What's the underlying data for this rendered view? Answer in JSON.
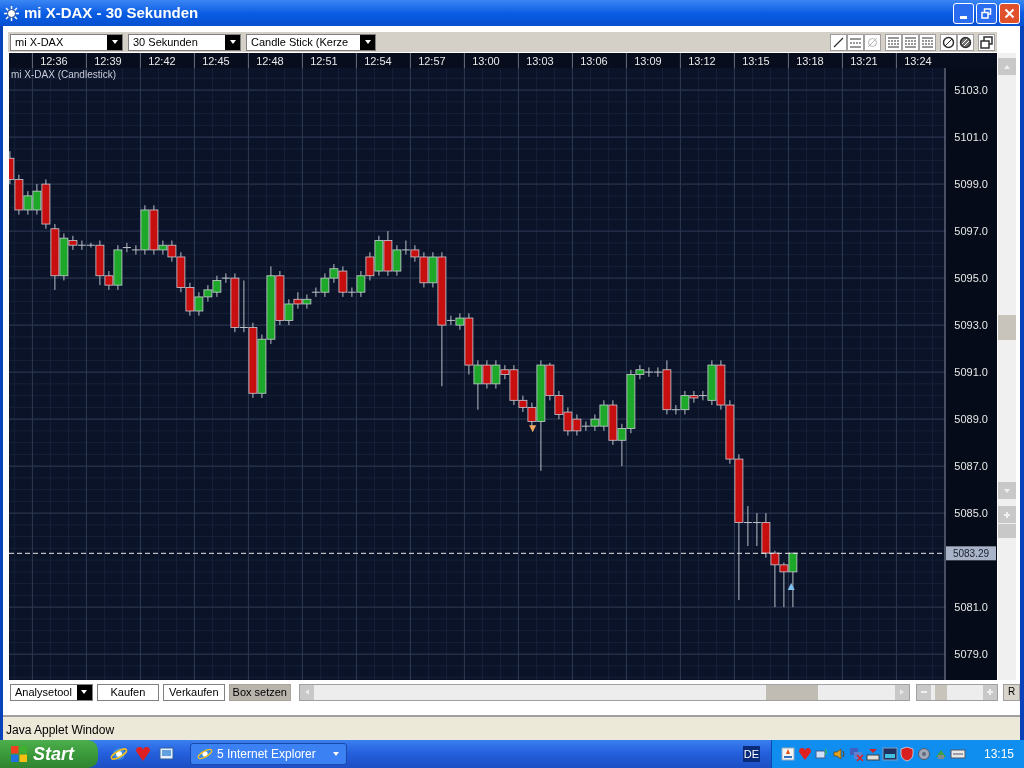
{
  "window": {
    "title": "mi X-DAX - 30 Sekunden"
  },
  "toolbar": {
    "dropdowns": [
      {
        "value": "mi X-DAX"
      },
      {
        "value": "30 Sekunden"
      },
      {
        "value": "Candle Stick (Kerze"
      }
    ],
    "tools": [
      {
        "kind": "line",
        "disabled": false
      },
      {
        "kind": "hlines",
        "disabled": false
      },
      {
        "kind": "slash",
        "disabled": true
      },
      {
        "kind": "grid",
        "disabled": false
      },
      {
        "kind": "grid",
        "disabled": false
      },
      {
        "kind": "grid",
        "disabled": false
      },
      {
        "kind": "target",
        "disabled": false
      },
      {
        "kind": "hatch",
        "disabled": false
      },
      {
        "kind": "windows",
        "disabled": false
      }
    ]
  },
  "chart": {
    "chart_data": {
      "type": "candlestick",
      "title": "mi X-DAX (Candlestick)",
      "grid": true,
      "ylim": [
        5077.9,
        5103.94
      ],
      "yticks": [
        {
          "value": 5103,
          "label": "5103.0"
        },
        {
          "value": 5101,
          "label": "5101.0"
        },
        {
          "value": 5099,
          "label": "5099.0"
        },
        {
          "value": 5097,
          "label": "5097.0"
        },
        {
          "value": 5095,
          "label": "5095.0"
        },
        {
          "value": 5093,
          "label": "5093.0"
        },
        {
          "value": 5091,
          "label": "5091.0"
        },
        {
          "value": 5089,
          "label": "5089.0"
        },
        {
          "value": 5087,
          "label": "5087.0"
        },
        {
          "value": 5085,
          "label": "5085.0"
        },
        {
          "value": 5081,
          "label": "5081.0"
        },
        {
          "value": 5079,
          "label": "5079.0"
        }
      ],
      "categories": [
        null,
        null,
        null,
        null,
        null,
        "12:36",
        null,
        null,
        null,
        null,
        null,
        "12:39",
        null,
        null,
        null,
        null,
        null,
        "12:42",
        null,
        null,
        null,
        null,
        null,
        "12:45",
        null,
        null,
        null,
        null,
        null,
        "12:48",
        null,
        null,
        null,
        null,
        null,
        "12:51",
        null,
        null,
        null,
        null,
        null,
        "12:54",
        null,
        null,
        null,
        null,
        null,
        "12:57",
        null,
        null,
        null,
        null,
        null,
        "13:00",
        null,
        null,
        null,
        null,
        null,
        "13:03",
        null,
        null,
        null,
        null,
        null,
        "13:06",
        null,
        null,
        null,
        null,
        null,
        "13:09",
        null,
        null,
        null,
        null,
        null,
        "13:12",
        null,
        null,
        null,
        null,
        null,
        "13:15",
        null,
        null,
        null,
        null,
        null,
        "13:18",
        null,
        null,
        null,
        null,
        null,
        "13:21",
        null,
        null,
        null,
        null,
        null,
        "13:24",
        null,
        null
      ],
      "ohlc": [
        [
          5100.1,
          5100.4,
          5099.0,
          5099.2
        ],
        [
          5099.2,
          5099.4,
          5097.7,
          5097.9
        ],
        [
          5097.9,
          5098.7,
          5097.7,
          5098.5
        ],
        [
          5097.9,
          5099.0,
          5097.7,
          5098.7
        ],
        [
          5099.0,
          5099.2,
          5097.1,
          5097.3
        ],
        [
          5097.1,
          5097.3,
          5094.5,
          5095.1
        ],
        [
          5095.1,
          5096.9,
          5094.9,
          5096.7
        ],
        [
          5096.6,
          5096.8,
          5096.2,
          5096.4
        ],
        [
          5096.4,
          5096.6,
          5096.2,
          5096.4
        ],
        [
          5096.4,
          5096.5,
          5096.3,
          5096.4
        ],
        [
          5096.4,
          5096.6,
          5094.7,
          5095.1
        ],
        [
          5095.1,
          5095.3,
          5094.5,
          5094.7
        ],
        [
          5094.7,
          5096.4,
          5094.5,
          5096.2
        ],
        [
          5096.3,
          5096.5,
          5096.1,
          5096.3
        ],
        [
          5096.2,
          5096.4,
          5096.0,
          5096.2
        ],
        [
          5096.2,
          5098.1,
          5096.0,
          5097.9
        ],
        [
          5097.9,
          5098.1,
          5096.0,
          5096.2
        ],
        [
          5096.2,
          5096.6,
          5096.0,
          5096.4
        ],
        [
          5096.4,
          5096.6,
          5095.7,
          5095.9
        ],
        [
          5095.9,
          5096.1,
          5094.4,
          5094.6
        ],
        [
          5094.6,
          5094.8,
          5093.4,
          5093.6
        ],
        [
          5093.6,
          5094.4,
          5093.4,
          5094.2
        ],
        [
          5094.2,
          5094.7,
          5094.0,
          5094.5
        ],
        [
          5094.4,
          5095.1,
          5094.2,
          5094.9
        ],
        [
          5095.0,
          5095.2,
          5094.8,
          5095.0
        ],
        [
          5095.0,
          5095.2,
          5092.7,
          5092.9
        ],
        [
          5092.9,
          5094.9,
          5092.7,
          5092.9
        ],
        [
          5092.9,
          5093.1,
          5089.9,
          5090.1
        ],
        [
          5090.1,
          5092.6,
          5089.9,
          5092.4
        ],
        [
          5092.4,
          5095.5,
          5092.2,
          5095.1
        ],
        [
          5095.1,
          5095.3,
          5093.0,
          5093.2
        ],
        [
          5093.2,
          5094.1,
          5093.0,
          5093.9
        ],
        [
          5094.1,
          5094.4,
          5093.7,
          5093.9
        ],
        [
          5093.9,
          5094.3,
          5093.7,
          5094.1
        ],
        [
          5094.4,
          5094.6,
          5094.2,
          5094.4
        ],
        [
          5094.4,
          5095.2,
          5094.2,
          5095.0
        ],
        [
          5095.0,
          5095.6,
          5094.8,
          5095.4
        ],
        [
          5095.3,
          5095.5,
          5094.2,
          5094.4
        ],
        [
          5094.4,
          5094.6,
          5094.2,
          5094.4
        ],
        [
          5094.4,
          5095.3,
          5094.2,
          5095.1
        ],
        [
          5095.9,
          5096.1,
          5094.9,
          5095.1
        ],
        [
          5095.3,
          5096.8,
          5095.1,
          5096.6
        ],
        [
          5096.6,
          5097.0,
          5095.1,
          5095.3
        ],
        [
          5095.3,
          5096.4,
          5095.1,
          5096.2
        ],
        [
          5096.2,
          5096.6,
          5096.0,
          5096.2
        ],
        [
          5096.2,
          5096.4,
          5095.7,
          5095.9
        ],
        [
          5095.9,
          5096.1,
          5094.6,
          5094.8
        ],
        [
          5094.8,
          5096.1,
          5094.6,
          5095.9
        ],
        [
          5095.9,
          5096.1,
          5090.4,
          5093.0
        ],
        [
          5093.2,
          5093.4,
          5093.0,
          5093.2
        ],
        [
          5093.0,
          5093.5,
          5092.8,
          5093.3
        ],
        [
          5093.3,
          5093.5,
          5090.9,
          5091.3
        ],
        [
          5090.5,
          5091.5,
          5089.4,
          5091.3
        ],
        [
          5091.3,
          5091.5,
          5090.3,
          5090.5
        ],
        [
          5090.5,
          5091.5,
          5090.3,
          5091.3
        ],
        [
          5091.1,
          5091.3,
          5090.7,
          5090.9
        ],
        [
          5091.1,
          5091.3,
          5089.6,
          5089.8
        ],
        [
          5089.8,
          5090.0,
          5089.3,
          5089.5
        ],
        [
          5089.5,
          5089.7,
          5088.7,
          5088.9
        ],
        [
          5088.9,
          5091.5,
          5086.8,
          5091.3
        ],
        [
          5091.3,
          5091.4,
          5089.8,
          5090.0
        ],
        [
          5090.0,
          5090.2,
          5089.0,
          5089.2
        ],
        [
          5089.3,
          5089.5,
          5088.3,
          5088.5
        ],
        [
          5089.0,
          5089.2,
          5088.3,
          5088.5
        ],
        [
          5088.7,
          5088.9,
          5088.5,
          5088.7
        ],
        [
          5088.7,
          5089.2,
          5088.5,
          5089.0
        ],
        [
          5088.7,
          5089.8,
          5088.5,
          5089.6
        ],
        [
          5089.6,
          5089.8,
          5087.9,
          5088.1
        ],
        [
          5088.1,
          5088.8,
          5087.0,
          5088.6
        ],
        [
          5088.6,
          5091.1,
          5088.4,
          5090.9
        ],
        [
          5090.9,
          5091.3,
          5090.7,
          5091.1
        ],
        [
          5091.0,
          5091.2,
          5090.8,
          5091.0
        ],
        [
          5091.0,
          5091.2,
          5090.8,
          5091.0
        ],
        [
          5091.1,
          5091.5,
          5089.2,
          5089.4
        ],
        [
          5089.4,
          5089.6,
          5089.2,
          5089.4
        ],
        [
          5089.4,
          5090.2,
          5089.2,
          5090.0
        ],
        [
          5090.0,
          5090.2,
          5089.7,
          5089.9
        ],
        [
          5090.0,
          5090.2,
          5089.8,
          5090.0
        ],
        [
          5089.8,
          5091.5,
          5089.6,
          5091.3
        ],
        [
          5091.3,
          5091.5,
          5089.4,
          5089.6
        ],
        [
          5089.6,
          5089.8,
          5087.1,
          5087.3
        ],
        [
          5087.3,
          5087.5,
          5081.3,
          5084.6
        ],
        [
          5084.6,
          5085.3,
          5083.6,
          5084.6
        ],
        [
          5084.6,
          5085.0,
          5083.6,
          5084.6
        ],
        [
          5084.6,
          5085.0,
          5083.1,
          5083.3
        ],
        [
          5083.3,
          5083.4,
          5081.0,
          5082.8
        ],
        [
          5082.8,
          5082.9,
          5081.0,
          5082.5
        ],
        [
          5082.5,
          5083.3,
          5081.0,
          5083.3
        ],
        null,
        null,
        null,
        null,
        null,
        null,
        null,
        null,
        null,
        null,
        null,
        null,
        null,
        null,
        null,
        null
      ],
      "annotations": [
        "▼",
        "▲"
      ],
      "ref_lines": [
        {
          "axis": "y",
          "value": 5083.29,
          "label": "5083.29"
        }
      ]
    },
    "markers": [
      {
        "color": "#f0a860"
      },
      {
        "color": "#80c0f0"
      }
    ]
  },
  "bottom_bar": {
    "dropdown": {
      "value": "Analysetool"
    },
    "buttons": [
      {
        "label": "Kaufen",
        "selected": false
      },
      {
        "label": "Verkaufen",
        "selected": false
      },
      {
        "label": "Box setzen",
        "selected": true
      }
    ],
    "zoom": {
      "level": 0.2
    },
    "reset_button": "R"
  },
  "status_bar": {
    "text": "Java Applet Window"
  },
  "taskbar": {
    "start": "Start",
    "tasks": [
      {
        "label": "5 Internet Explorer"
      }
    ],
    "language": "DE",
    "clock": "13:15"
  }
}
